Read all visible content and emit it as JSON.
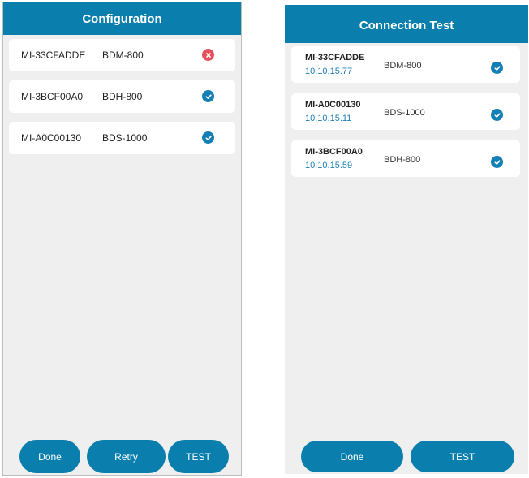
{
  "left_panel": {
    "title": "Configuration",
    "devices": [
      {
        "id": "MI-33CFADDE",
        "model": "BDM-800",
        "status": "error"
      },
      {
        "id": "MI-3BCF00A0",
        "model": "BDH-800",
        "status": "ok"
      },
      {
        "id": "MI-A0C00130",
        "model": "BDS-1000",
        "status": "ok"
      }
    ],
    "buttons": {
      "done": "Done",
      "retry": "Retry",
      "test": "TEST"
    }
  },
  "right_panel": {
    "title": "Connection Test",
    "devices": [
      {
        "id": "MI-33CFADDE",
        "ip": "10.10.15.77",
        "model": "BDM-800",
        "status": "ok"
      },
      {
        "id": "MI-A0C00130",
        "ip": "10.10.15.11",
        "model": "BDS-1000",
        "status": "ok"
      },
      {
        "id": "MI-3BCF00A0",
        "ip": "10.10.15.59",
        "model": "BDH-800",
        "status": "ok"
      }
    ],
    "buttons": {
      "done": "Done",
      "test": "TEST"
    }
  },
  "colors": {
    "accent": "#0a7fad",
    "ok": "#137fb5",
    "error": "#e5505a",
    "background": "#efefef",
    "ip_text": "#1a7fb5"
  },
  "icons": {
    "ok": "check-circle-icon",
    "error": "x-circle-icon"
  }
}
